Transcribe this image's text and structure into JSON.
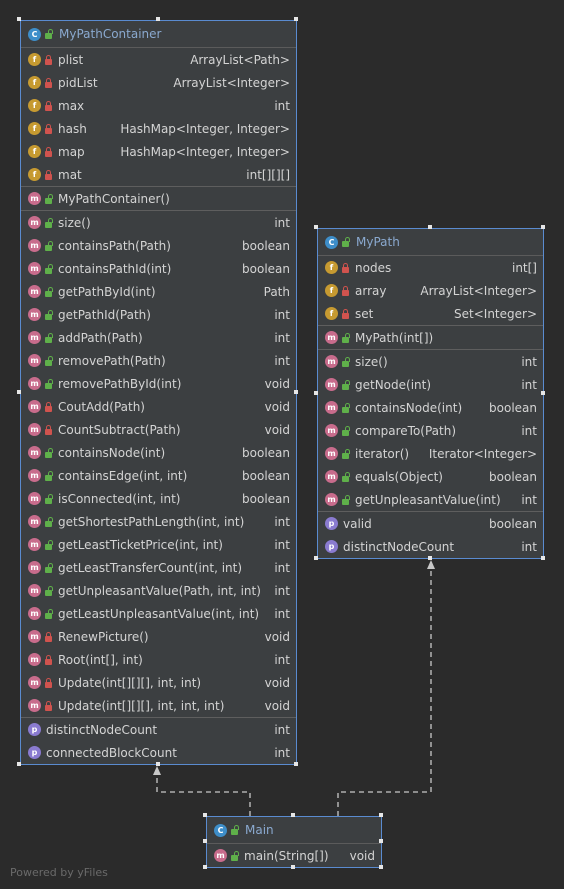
{
  "diagram": {
    "classes": [
      {
        "id": "mypathcontainer",
        "name": "MyPathContainer",
        "sections": [
          [
            {
              "kind": "f",
              "vis": "priv",
              "name": "plist",
              "type": "ArrayList<Path>"
            },
            {
              "kind": "f",
              "vis": "priv",
              "name": "pidList",
              "type": "ArrayList<Integer>"
            },
            {
              "kind": "f",
              "vis": "priv",
              "name": "max",
              "type": "int"
            },
            {
              "kind": "f",
              "vis": "priv",
              "name": "hash",
              "type": "HashMap<Integer, Integer>"
            },
            {
              "kind": "f",
              "vis": "priv",
              "name": "map",
              "type": "HashMap<Integer, Integer>"
            },
            {
              "kind": "f",
              "vis": "priv",
              "name": "mat",
              "type": "int[][][]"
            }
          ],
          [
            {
              "kind": "m",
              "vis": "pub",
              "name": "MyPathContainer()",
              "type": ""
            }
          ],
          [
            {
              "kind": "m",
              "vis": "pub",
              "name": "size()",
              "type": "int"
            },
            {
              "kind": "m",
              "vis": "pub",
              "name": "containsPath(Path)",
              "type": "boolean"
            },
            {
              "kind": "m",
              "vis": "pub",
              "name": "containsPathId(int)",
              "type": "boolean"
            },
            {
              "kind": "m",
              "vis": "pub",
              "name": "getPathById(int)",
              "type": "Path"
            },
            {
              "kind": "m",
              "vis": "pub",
              "name": "getPathId(Path)",
              "type": "int"
            },
            {
              "kind": "m",
              "vis": "pub",
              "name": "addPath(Path)",
              "type": "int"
            },
            {
              "kind": "m",
              "vis": "pub",
              "name": "removePath(Path)",
              "type": "int"
            },
            {
              "kind": "m",
              "vis": "pub",
              "name": "removePathById(int)",
              "type": "void"
            },
            {
              "kind": "m",
              "vis": "priv",
              "name": "CoutAdd(Path)",
              "type": "void"
            },
            {
              "kind": "m",
              "vis": "priv",
              "name": "CountSubtract(Path)",
              "type": "void"
            },
            {
              "kind": "m",
              "vis": "pub",
              "name": "containsNode(int)",
              "type": "boolean"
            },
            {
              "kind": "m",
              "vis": "pub",
              "name": "containsEdge(int, int)",
              "type": "boolean"
            },
            {
              "kind": "m",
              "vis": "pub",
              "name": "isConnected(int, int)",
              "type": "boolean"
            },
            {
              "kind": "m",
              "vis": "pub",
              "name": "getShortestPathLength(int, int)",
              "type": "int"
            },
            {
              "kind": "m",
              "vis": "pub",
              "name": "getLeastTicketPrice(int, int)",
              "type": "int"
            },
            {
              "kind": "m",
              "vis": "pub",
              "name": "getLeastTransferCount(int, int)",
              "type": "int"
            },
            {
              "kind": "m",
              "vis": "pub",
              "name": "getUnpleasantValue(Path, int, int)",
              "type": "int"
            },
            {
              "kind": "m",
              "vis": "pub",
              "name": "getLeastUnpleasantValue(int, int)",
              "type": "int"
            },
            {
              "kind": "m",
              "vis": "priv",
              "name": "RenewPicture()",
              "type": "void"
            },
            {
              "kind": "m",
              "vis": "priv",
              "name": "Root(int[], int)",
              "type": "int"
            },
            {
              "kind": "m",
              "vis": "priv",
              "name": "Update(int[][][], int, int)",
              "type": "void"
            },
            {
              "kind": "m",
              "vis": "priv",
              "name": "Update(int[][][], int, int, int)",
              "type": "void"
            }
          ],
          [
            {
              "kind": "p",
              "vis": "none",
              "name": "distinctNodeCount",
              "type": "int"
            },
            {
              "kind": "p",
              "vis": "none",
              "name": "connectedBlockCount",
              "type": "int"
            }
          ]
        ]
      },
      {
        "id": "mypath",
        "name": "MyPath",
        "sections": [
          [
            {
              "kind": "f",
              "vis": "priv",
              "name": "nodes",
              "type": "int[]"
            },
            {
              "kind": "f",
              "vis": "priv",
              "name": "array",
              "type": "ArrayList<Integer>"
            },
            {
              "kind": "f",
              "vis": "priv",
              "name": "set",
              "type": "Set<Integer>"
            }
          ],
          [
            {
              "kind": "m",
              "vis": "pub",
              "name": "MyPath(int[])",
              "type": ""
            }
          ],
          [
            {
              "kind": "m",
              "vis": "pub",
              "name": "size()",
              "type": "int"
            },
            {
              "kind": "m",
              "vis": "pub",
              "name": "getNode(int)",
              "type": "int"
            },
            {
              "kind": "m",
              "vis": "pub",
              "name": "containsNode(int)",
              "type": "boolean"
            },
            {
              "kind": "m",
              "vis": "pub",
              "name": "compareTo(Path)",
              "type": "int"
            },
            {
              "kind": "m",
              "vis": "pub",
              "name": "iterator()",
              "type": "Iterator<Integer>"
            },
            {
              "kind": "m",
              "vis": "pub",
              "name": "equals(Object)",
              "type": "boolean"
            },
            {
              "kind": "m",
              "vis": "pub",
              "name": "getUnpleasantValue(int)",
              "type": "int"
            }
          ],
          [
            {
              "kind": "p",
              "vis": "none",
              "name": "valid",
              "type": "boolean"
            },
            {
              "kind": "p",
              "vis": "none",
              "name": "distinctNodeCount",
              "type": "int"
            }
          ]
        ]
      },
      {
        "id": "main",
        "name": "Main",
        "sections": [
          [
            {
              "kind": "m",
              "vis": "pub",
              "name": "main(String[])",
              "type": "void"
            }
          ]
        ]
      }
    ],
    "edges": [
      {
        "from": "main",
        "to": "mypathcontainer",
        "style": "dashed"
      },
      {
        "from": "main",
        "to": "mypath",
        "style": "dashed"
      }
    ]
  },
  "footer": "Powered by yFiles",
  "colors": {
    "background": "#2b2b2b",
    "node_fill": "#3c3f41",
    "node_border": "#5a8bd0",
    "class_icon": "#3e8ec9",
    "field_icon": "#c69a31",
    "method_icon": "#c86c8c",
    "property_icon": "#8a7bd0",
    "private_lock": "#d0534e",
    "public_lock": "#5fb04a",
    "edge": "#c8c8c8"
  }
}
